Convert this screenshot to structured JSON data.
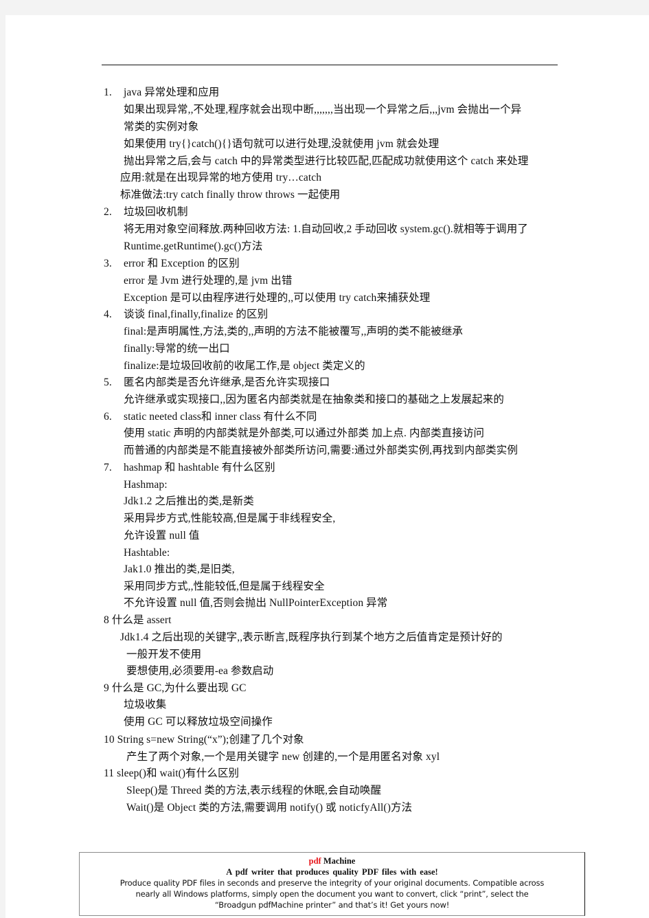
{
  "document": {
    "lines": [
      {
        "num": "1.",
        "text": "java  异常处理和应用"
      },
      {
        "text": "如果出现异常,,不处理,程序就会出现中断,,,,,,,当出现一个异常之后,,,jvm  会抛出一个异"
      },
      {
        "text": "常类的实例对象"
      },
      {
        "text": "如果使用 try{}catch(){}语句就可以进行处理,没就使用 jvm 就会处理"
      },
      {
        "text": "抛出异常之后,会与 catch  中的异常类型进行比较匹配,匹配成功就使用这个 catch 来处理"
      },
      {
        "text": "应用:就是在出现异常的地方使用  try…catch"
      },
      {
        "text": "标准做法:try  catch  finally  throw  throws 一起使用"
      },
      {
        "num": "2.",
        "text": "垃圾回收机制"
      },
      {
        "text": "将无用对象空间释放.两种回收方法: 1.自动回收,2 手动回收 system.gc().就相等于调用了"
      },
      {
        "text": "Runtime.getRuntime().gc()方法"
      },
      {
        "num": "3.",
        "text": "error  和 Exception  的区别"
      },
      {
        "text": "error 是 Jvm 进行处理的,是 jvm 出错"
      },
      {
        "text": "Exception  是可以由程序进行处理的,,可以使用 try  catch来捕获处理"
      },
      {
        "num": "4.",
        "text": "谈谈 final,finally,finalize 的区别"
      },
      {
        "text": "final:是声明属性,方法,类的,,声明的方法不能被覆写,,声明的类不能被继承"
      },
      {
        "text": "finally:导常的统一出口"
      },
      {
        "text": "finalize:是垃圾回收前的收尾工作,是 object 类定义的"
      },
      {
        "num": "5.",
        "text": "匿名内部类是否允许继承,是否允许实现接口"
      },
      {
        "text": "允许继承或实现接口,,因为匿名内部类就是在抽象类和接口的基础之上发展起来的"
      },
      {
        "num": "6.",
        "text": "static  neeted  class和 inner  class 有什么不同"
      },
      {
        "text": "使用 static 声明的内部类就是外部类,可以通过外部类    加上点.  内部类直接访问"
      },
      {
        "text": "而普通的内部类是不能直接被外部类所访问,需要:通过外部类实例,再找到内部类实例"
      },
      {
        "num": "7.",
        "text": "hashmap  和 hashtable 有什么区别"
      },
      {
        "text": "Hashmap:"
      },
      {
        "text": "Jdk1.2 之后推出的类,是新类"
      },
      {
        "text": "采用异步方式,性能较高,但是属于非线程安全,"
      },
      {
        "text": "允许设置 null 值"
      },
      {
        "text": "Hashtable:"
      },
      {
        "text": "Jak1.0 推出的类,是旧类,"
      },
      {
        "text": "采用同步方式,,性能较低,但是属于线程安全"
      },
      {
        "text": "不允许设置 null 值,否则会抛出 NullPointerException 异常"
      },
      {
        "text": "8  什么是 assert"
      },
      {
        "text": "Jdk1.4 之后出现的关键字,,表示断言,既程序执行到某个地方之后值肯定是预计好的"
      },
      {
        "text": "一般开发不使用"
      },
      {
        "text": "要想使用,必须要用-ea 参数启动"
      },
      {
        "text": "9  什么是  GC,为什么要出现  GC"
      },
      {
        "text": "垃圾收集"
      },
      {
        "text": "使用 GC 可以释放垃圾空间操作"
      },
      {
        "text": "10  String  s=new  String(“x”);创建了几个对象"
      },
      {
        "text": "产生了两个对象,一个是用关键字 new  创建的,一个是用匿名对象 xyl"
      },
      {
        "text": "11  sleep()和 wait()有什么区别"
      },
      {
        "text": "Sleep()是 Threed 类的方法,表示线程的休眠,会自动唤醒"
      },
      {
        "text": "Wait()是 Object  类的方法,需要调用 notify()  或 noticfyAll()方法"
      }
    ]
  },
  "footer": {
    "brand_red": "pdf",
    "brand_rest": " Machine",
    "tagline": "A pdf writer that produces quality PDF files with ease!",
    "body_1": "Produce quality PDF files in seconds and preserve the integrity of your original documents. Compatible across",
    "body_2": "nearly all Windows platforms, simply open the document you want to convert, click “print”, select the",
    "body_3": "“Broadgun pdfMachine printer” and that’s it! Get yours now!",
    "brand_color": "#e8161b"
  }
}
